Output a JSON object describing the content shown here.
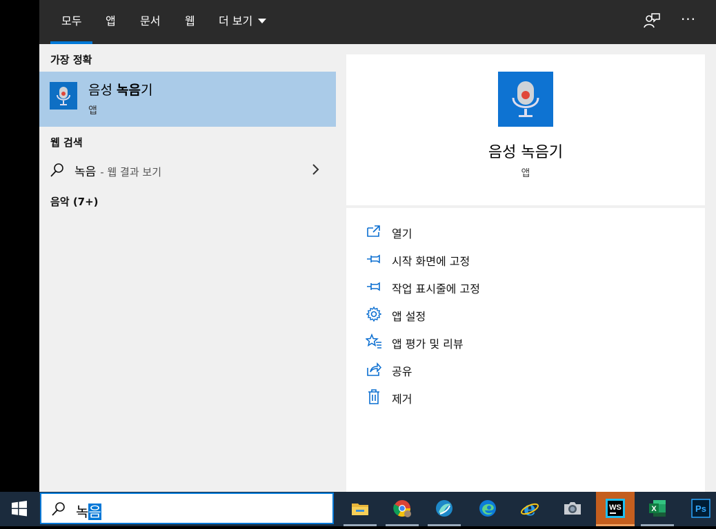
{
  "tabs": [
    {
      "label": "모두",
      "active": true
    },
    {
      "label": "앱"
    },
    {
      "label": "문서"
    },
    {
      "label": "웹"
    },
    {
      "label": "더 보기"
    }
  ],
  "toolbar": {
    "feedback_icon": "feedback-icon",
    "more_label": "···"
  },
  "left": {
    "best_match_header": "가장 정확",
    "best_match": {
      "title_prefix": "음성 ",
      "title_bold": "녹음",
      "title_suffix": "기",
      "subtitle": "앱"
    },
    "web_header": "웹 검색",
    "web_item": {
      "query": "녹음",
      "suffix": "- 웹 결과 보기"
    },
    "music_header": "음악 (7+)"
  },
  "preview": {
    "title": "음성 녹음기",
    "subtitle": "앱"
  },
  "actions": [
    {
      "label": "열기",
      "icon": "open-icon"
    },
    {
      "label": "시작 화면에 고정",
      "icon": "pin-icon"
    },
    {
      "label": "작업 표시줄에 고정",
      "icon": "pin-icon"
    },
    {
      "label": "앱 설정",
      "icon": "gear-icon"
    },
    {
      "label": "앱 평가 및 리뷰",
      "icon": "star-review-icon"
    },
    {
      "label": "공유",
      "icon": "share-icon"
    },
    {
      "label": "제거",
      "icon": "trash-icon"
    }
  ],
  "search": {
    "typed": "녹",
    "selected": "음"
  },
  "taskbar": {
    "apps": [
      "file-explorer-icon",
      "chrome-icon",
      "app-icon",
      "edge-icon",
      "internet-explorer-icon",
      "camera-icon",
      "webstorm-icon",
      "excel-icon",
      "photoshop-icon"
    ],
    "badges": {
      "webstorm": "WS",
      "excel": "X",
      "photoshop": "Ps"
    }
  },
  "colors": {
    "accent": "#0078d7",
    "selection": "#aacbe8",
    "panel": "#f0f0f0",
    "topbar": "#2b2b2b",
    "taskbar": "#1b2b3d"
  }
}
